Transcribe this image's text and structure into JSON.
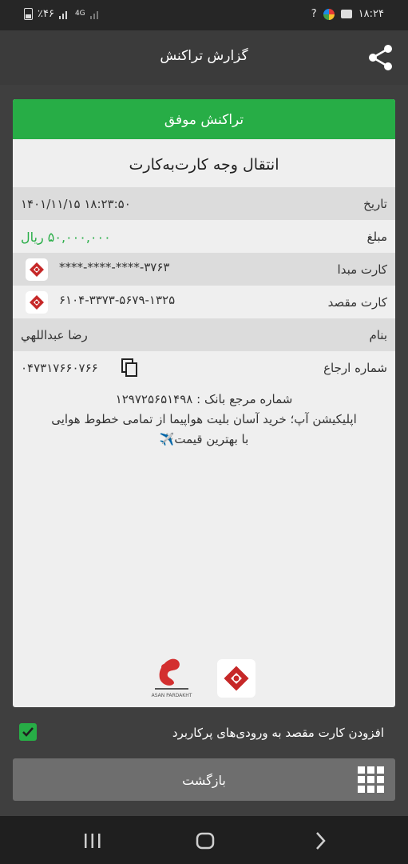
{
  "status_bar": {
    "battery": "٪۴۶",
    "network": "4G",
    "time": "۱۸:۲۴",
    "question": "?"
  },
  "header": {
    "title": "گزارش تراکنش",
    "share_icon": "share-icon"
  },
  "receipt": {
    "status": "تراکنش موفق",
    "type": "انتقال وجه کارت‌به‌کارت",
    "date_label": "تاریخ",
    "date_value": "۱۴۰۱/۱۱/۱۵ ۱۸:۲۳:۵۰",
    "amount_label": "مبلغ",
    "amount_value": "۵۰,۰۰۰,۰۰۰ ریال",
    "source_label": "کارت مبدا",
    "source_value": "****-****-****-۳۷۶۳",
    "dest_label": "کارت مقصد",
    "dest_value": "۶۱۰۴-۳۳۷۳-۵۶۷۹-۱۳۲۵",
    "name_label": "بنام",
    "name_value": "رضا عبداللهي",
    "ref_label": "شماره ارجاع",
    "ref_value": "۰۴۷۳۱۷۶۶۰۷۶۶",
    "bank_ref_line": "شماره مرجع بانک : ۱۲۹۷۲۵۶۵۱۴۹۸",
    "ad_line1": "اپلیکیشن آپ؛ خرید آسان بلیت هواپیما از تمامی خطوط هوایی",
    "ad_line2": "با بهترین قیمت✈️",
    "logo_ap_text": "ASAN PARDAKHT"
  },
  "add_dest": {
    "label": "افزودن کارت مقصد به ورودی‌های پرکاربرد",
    "checked": true
  },
  "back_button": {
    "label": "بازگشت"
  },
  "colors": {
    "success": "#27ad46",
    "bank": "#c62828"
  }
}
